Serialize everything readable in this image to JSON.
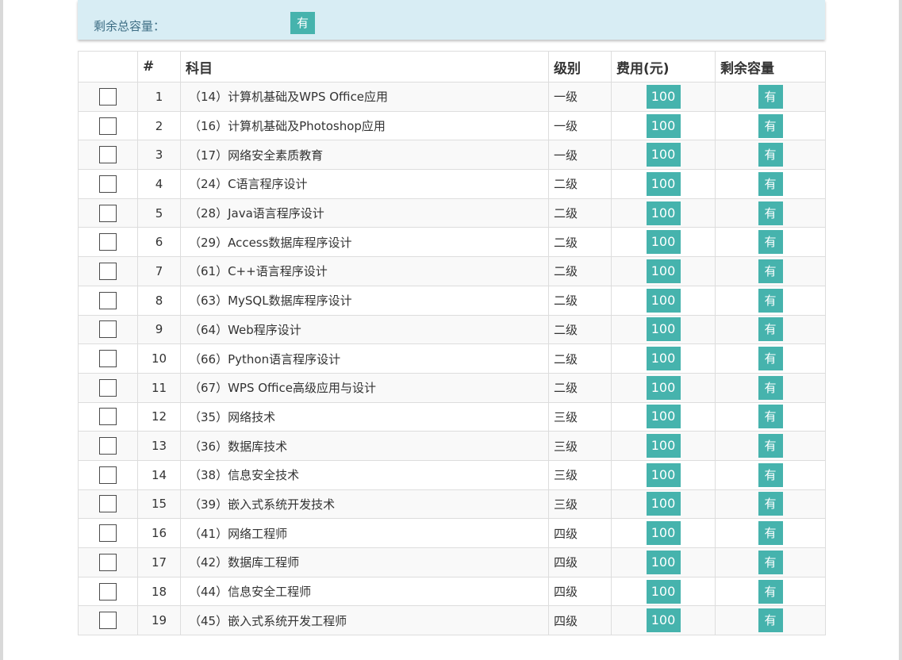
{
  "summary": {
    "label": "剩余总容量：",
    "badge": "有"
  },
  "table": {
    "headers": {
      "check": "",
      "num": "#",
      "subject": "科目",
      "level": "级别",
      "fee": "费用(元)",
      "capacity": "剩余容量"
    },
    "rows": [
      {
        "num": "1",
        "subject": "（14）计算机基础及WPS Office应用",
        "level": "一级",
        "fee": "100",
        "capacity": "有"
      },
      {
        "num": "2",
        "subject": "（16）计算机基础及Photoshop应用",
        "level": "一级",
        "fee": "100",
        "capacity": "有"
      },
      {
        "num": "3",
        "subject": "（17）网络安全素质教育",
        "level": "一级",
        "fee": "100",
        "capacity": "有"
      },
      {
        "num": "4",
        "subject": "（24）C语言程序设计",
        "level": "二级",
        "fee": "100",
        "capacity": "有"
      },
      {
        "num": "5",
        "subject": "（28）Java语言程序设计",
        "level": "二级",
        "fee": "100",
        "capacity": "有"
      },
      {
        "num": "6",
        "subject": "（29）Access数据库程序设计",
        "level": "二级",
        "fee": "100",
        "capacity": "有"
      },
      {
        "num": "7",
        "subject": "（61）C++语言程序设计",
        "level": "二级",
        "fee": "100",
        "capacity": "有"
      },
      {
        "num": "8",
        "subject": "（63）MySQL数据库程序设计",
        "level": "二级",
        "fee": "100",
        "capacity": "有"
      },
      {
        "num": "9",
        "subject": "（64）Web程序设计",
        "level": "二级",
        "fee": "100",
        "capacity": "有"
      },
      {
        "num": "10",
        "subject": "（66）Python语言程序设计",
        "level": "二级",
        "fee": "100",
        "capacity": "有"
      },
      {
        "num": "11",
        "subject": "（67）WPS Office高级应用与设计",
        "level": "二级",
        "fee": "100",
        "capacity": "有"
      },
      {
        "num": "12",
        "subject": "（35）网络技术",
        "level": "三级",
        "fee": "100",
        "capacity": "有"
      },
      {
        "num": "13",
        "subject": "（36）数据库技术",
        "level": "三级",
        "fee": "100",
        "capacity": "有"
      },
      {
        "num": "14",
        "subject": "（38）信息安全技术",
        "level": "三级",
        "fee": "100",
        "capacity": "有"
      },
      {
        "num": "15",
        "subject": "（39）嵌入式系统开发技术",
        "level": "三级",
        "fee": "100",
        "capacity": "有"
      },
      {
        "num": "16",
        "subject": "（41）网络工程师",
        "level": "四级",
        "fee": "100",
        "capacity": "有"
      },
      {
        "num": "17",
        "subject": "（42）数据库工程师",
        "level": "四级",
        "fee": "100",
        "capacity": "有"
      },
      {
        "num": "18",
        "subject": "（44）信息安全工程师",
        "level": "四级",
        "fee": "100",
        "capacity": "有"
      },
      {
        "num": "19",
        "subject": "（45）嵌入式系统开发工程师",
        "level": "四级",
        "fee": "100",
        "capacity": "有"
      }
    ]
  },
  "colors": {
    "badge": "#46b3ad",
    "info_background": "#d8edf4",
    "info_text": "#3d6d84"
  }
}
